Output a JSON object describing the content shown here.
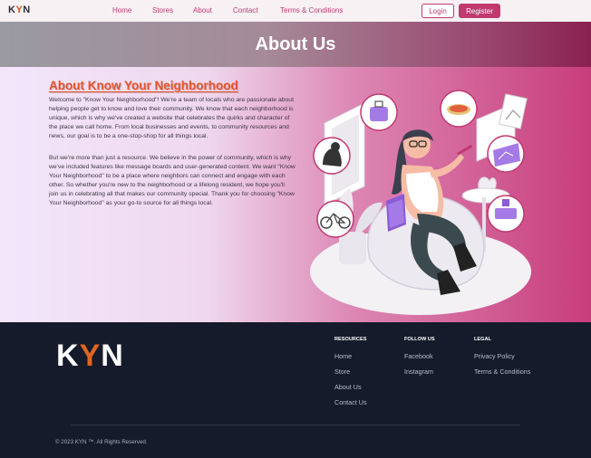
{
  "nav": {
    "logo_k": "K",
    "logo_y": "Y",
    "logo_n": "N",
    "links": [
      "Home",
      "Stores",
      "About",
      "Contact",
      "Terms & Conditions"
    ],
    "login": "Login",
    "register": "Register"
  },
  "hero": {
    "title": "About Us"
  },
  "content": {
    "title": "About Know Your Neighborhood",
    "paragraph1": "Welcome to \"Know Your Neighborhood\"! We're a team of locals who are passionate about helping people get to know and love their community. We know that each neighborhood is unique, which is why we've created a website that celebrates the quirks and character of the place we call home. From local businesses and events, to community resources and news, our goal is to be a one-stop-shop for all things local.",
    "paragraph2": "But we're more than just a resource. We believe in the power of community, which is why we've included features like message boards and user-generated content. We want \"Know Your Neighborhood\" to be a place where neighbors can connect and engage with each other. So whether you're new to the neighborhood or a lifelong resident, we hope you'll join us in celebrating all that makes our community special. Thank you for choosing \"Know Your Neighborhood\" as your go-to source for all things local."
  },
  "footer": {
    "logo_k": "K",
    "logo_y": "Y",
    "logo_n": "N",
    "resources": {
      "heading": "RESOURCES",
      "links": [
        "Home",
        "Store",
        "About Us",
        "Contact Us"
      ]
    },
    "follow": {
      "heading": "FOLLOW US",
      "links": [
        "Facebook",
        "Instagram"
      ]
    },
    "legal": {
      "heading": "LEGAL",
      "links": [
        "Privacy Policy",
        "Terms & Conditions"
      ]
    },
    "copyright": "© 2023 KYN ™. All Rights Reserved."
  },
  "colors": {
    "accent": "#c0396f",
    "title_orange": "#e2552b",
    "footer_bg": "#151b2a"
  },
  "icons": [
    "luggage-icon",
    "pizza-icon",
    "dog-icon",
    "map-icon",
    "bicycle-icon",
    "book-icon",
    "image-icon"
  ]
}
